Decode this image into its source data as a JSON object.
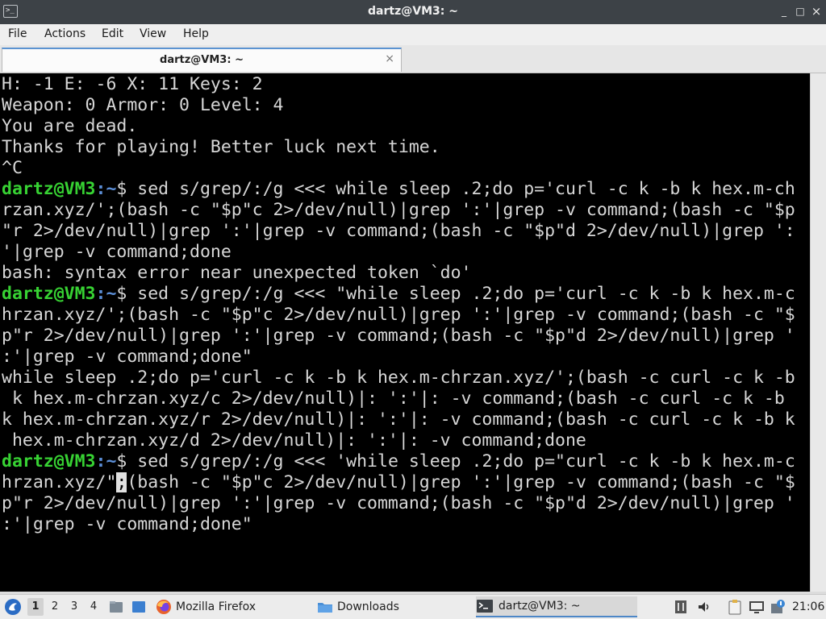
{
  "window": {
    "title": "dartz@VM3: ~",
    "app_icon": "terminal-icon",
    "controls": {
      "minimize": "_",
      "maximize": "□",
      "close": "×"
    }
  },
  "menu": {
    "items": [
      "File",
      "Actions",
      "Edit",
      "View",
      "Help"
    ]
  },
  "tabs": [
    {
      "label": "dartz@VM3: ~",
      "close": "×"
    }
  ],
  "terminal": {
    "colors": {
      "background": "#000000",
      "text": "#d7d7d7",
      "prompt_user": "#37d233",
      "prompt_path": "#5c8fd8"
    },
    "prompt": {
      "user": "dartz@VM3",
      "sep": ":",
      "path": "~",
      "sign": "$"
    },
    "lines": [
      {
        "text": "H: -1 E: -6 X: 11 Keys: 2"
      },
      {
        "text": "Weapon: 0 Armor: 0 Level: 4"
      },
      {
        "text": "You are dead."
      },
      {
        "text": "Thanks for playing! Better luck next time."
      },
      {
        "text": "^C"
      },
      {
        "prompt": true,
        "text": " sed s/grep/:/g <<< while sleep .2;do p='curl -c k -b k hex.m-ch"
      },
      {
        "text": "rzan.xyz/';(bash -c \"$p\"c 2>/dev/null)|grep ':'|grep -v command;(bash -c \"$p"
      },
      {
        "text": "\"r 2>/dev/null)|grep ':'|grep -v command;(bash -c \"$p\"d 2>/dev/null)|grep ':"
      },
      {
        "text": "'|grep -v command;done"
      },
      {
        "text": "bash: syntax error near unexpected token `do'"
      },
      {
        "prompt": true,
        "text": " sed s/grep/:/g <<< \"while sleep .2;do p='curl -c k -b k hex.m-c"
      },
      {
        "text": "hrzan.xyz/';(bash -c \"$p\"c 2>/dev/null)|grep ':'|grep -v command;(bash -c \"$"
      },
      {
        "text": "p\"r 2>/dev/null)|grep ':'|grep -v command;(bash -c \"$p\"d 2>/dev/null)|grep '"
      },
      {
        "text": ":'|grep -v command;done\""
      },
      {
        "text": "while sleep .2;do p='curl -c k -b k hex.m-chrzan.xyz/';(bash -c curl -c k -b"
      },
      {
        "text": " k hex.m-chrzan.xyz/c 2>/dev/null)|: ':'|: -v command;(bash -c curl -c k -b"
      },
      {
        "text": "k hex.m-chrzan.xyz/r 2>/dev/null)|: ':'|: -v command;(bash -c curl -c k -b k"
      },
      {
        "text": " hex.m-chrzan.xyz/d 2>/dev/null)|: ':'|: -v command;done"
      },
      {
        "prompt": true,
        "text": " sed s/grep/:/g <<< 'while sleep .2;do p=\"curl -c k -b k hex.m-c"
      },
      {
        "text": "hrzan.xyz/\"",
        "cursor": ";",
        "after": "(bash -c \"$p\"c 2>/dev/null)|grep ':'|grep -v command;(bash -c \"$"
      },
      {
        "text": "p\"r 2>/dev/null)|grep ':'|grep -v command;(bash -c \"$p\"d 2>/dev/null)|grep '"
      },
      {
        "text": ":'|grep -v command;done\""
      }
    ]
  },
  "taskbar": {
    "start_icon": "start-menu-icon",
    "workspaces": [
      "1",
      "2",
      "3",
      "4"
    ],
    "active_workspace": "1",
    "tasks": [
      {
        "label": "Mozilla Firefox",
        "icon": "firefox-icon"
      },
      {
        "label": "Downloads",
        "icon": "folder-icon"
      },
      {
        "label": "dartz@VM3: ~",
        "icon": "terminal-icon",
        "active": true
      }
    ],
    "tray_icons": [
      "mixer-icon",
      "volume-icon",
      "clipboard-icon",
      "network-icon",
      "update-icon"
    ],
    "clock": "21:06"
  }
}
